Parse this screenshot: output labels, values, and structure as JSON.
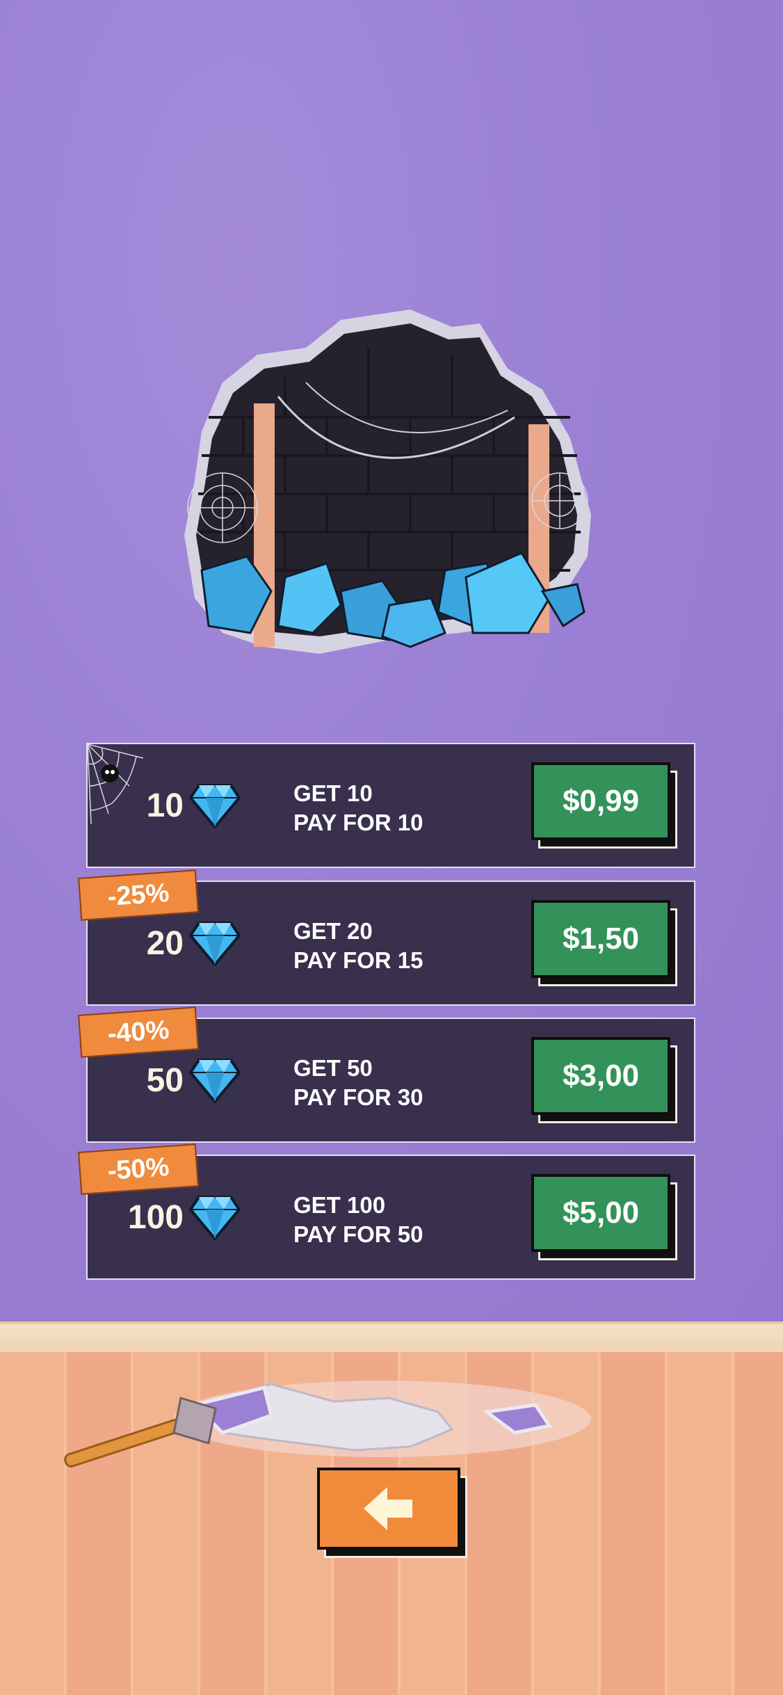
{
  "packs": [
    {
      "amount": "10",
      "line1": "GET 10",
      "line2": "PAY FOR 10",
      "price": "$0,99",
      "badge": ""
    },
    {
      "amount": "20",
      "line1": "GET 20",
      "line2": "PAY FOR 15",
      "price": "$1,50",
      "badge": "-25%"
    },
    {
      "amount": "50",
      "line1": "GET 50",
      "line2": "PAY FOR 30",
      "price": "$3,00",
      "badge": "-40%"
    },
    {
      "amount": "100",
      "line1": "GET 100",
      "line2": "PAY FOR 50",
      "price": "$5,00",
      "badge": "-50%"
    }
  ],
  "icons": {
    "gem": "blue-diamond-icon",
    "back": "arrow-left-icon"
  },
  "colors": {
    "wall": "#9b80d4",
    "card": "#39304e",
    "price_button": "#33925a",
    "badge": "#f08a3c",
    "back_button": "#f18b3b"
  }
}
